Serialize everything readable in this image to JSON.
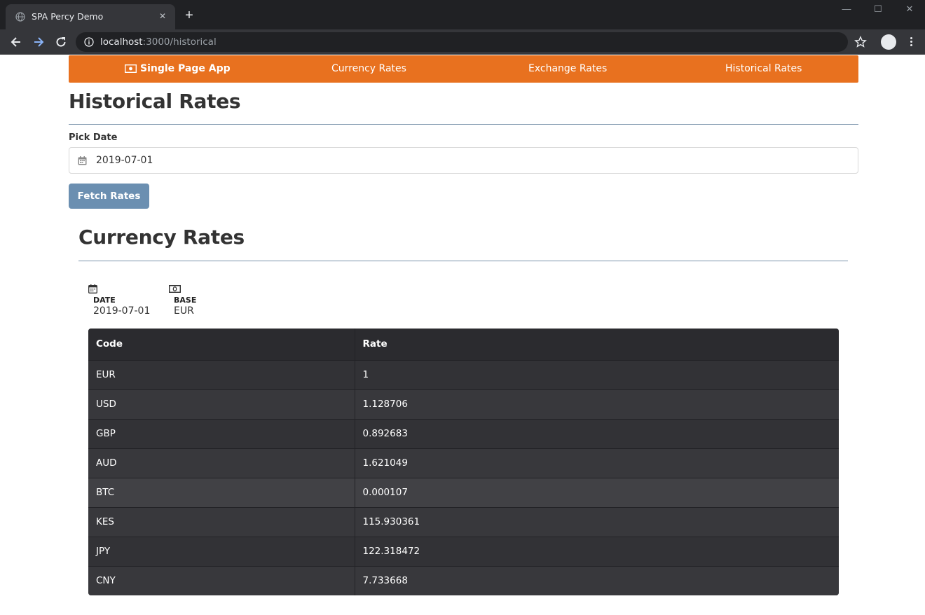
{
  "browser": {
    "tab_title": "SPA Percy Demo",
    "url_host": "localhost",
    "url_rest": ":3000/historical"
  },
  "nav": {
    "brand": "Single Page App",
    "links": [
      "Currency Rates",
      "Exchange Rates",
      "Historical Rates"
    ]
  },
  "page": {
    "title": "Historical Rates",
    "date_label": "Pick Date",
    "date_value": "2019-07-01",
    "fetch_button": "Fetch Rates"
  },
  "results": {
    "title": "Currency Rates",
    "date_label": "DATE",
    "date_value": "2019-07-01",
    "base_label": "BASE",
    "base_value": "EUR",
    "table": {
      "headers": [
        "Code",
        "Rate"
      ],
      "rows": [
        [
          "EUR",
          "1"
        ],
        [
          "USD",
          "1.128706"
        ],
        [
          "GBP",
          "0.892683"
        ],
        [
          "AUD",
          "1.621049"
        ],
        [
          "BTC",
          "0.000107"
        ],
        [
          "KES",
          "115.930361"
        ],
        [
          "JPY",
          "122.318472"
        ],
        [
          "CNY",
          "7.733668"
        ]
      ]
    }
  },
  "colors": {
    "navbar": "#e8711f",
    "button": "#6b8fb1",
    "table": "#2f2f33"
  }
}
